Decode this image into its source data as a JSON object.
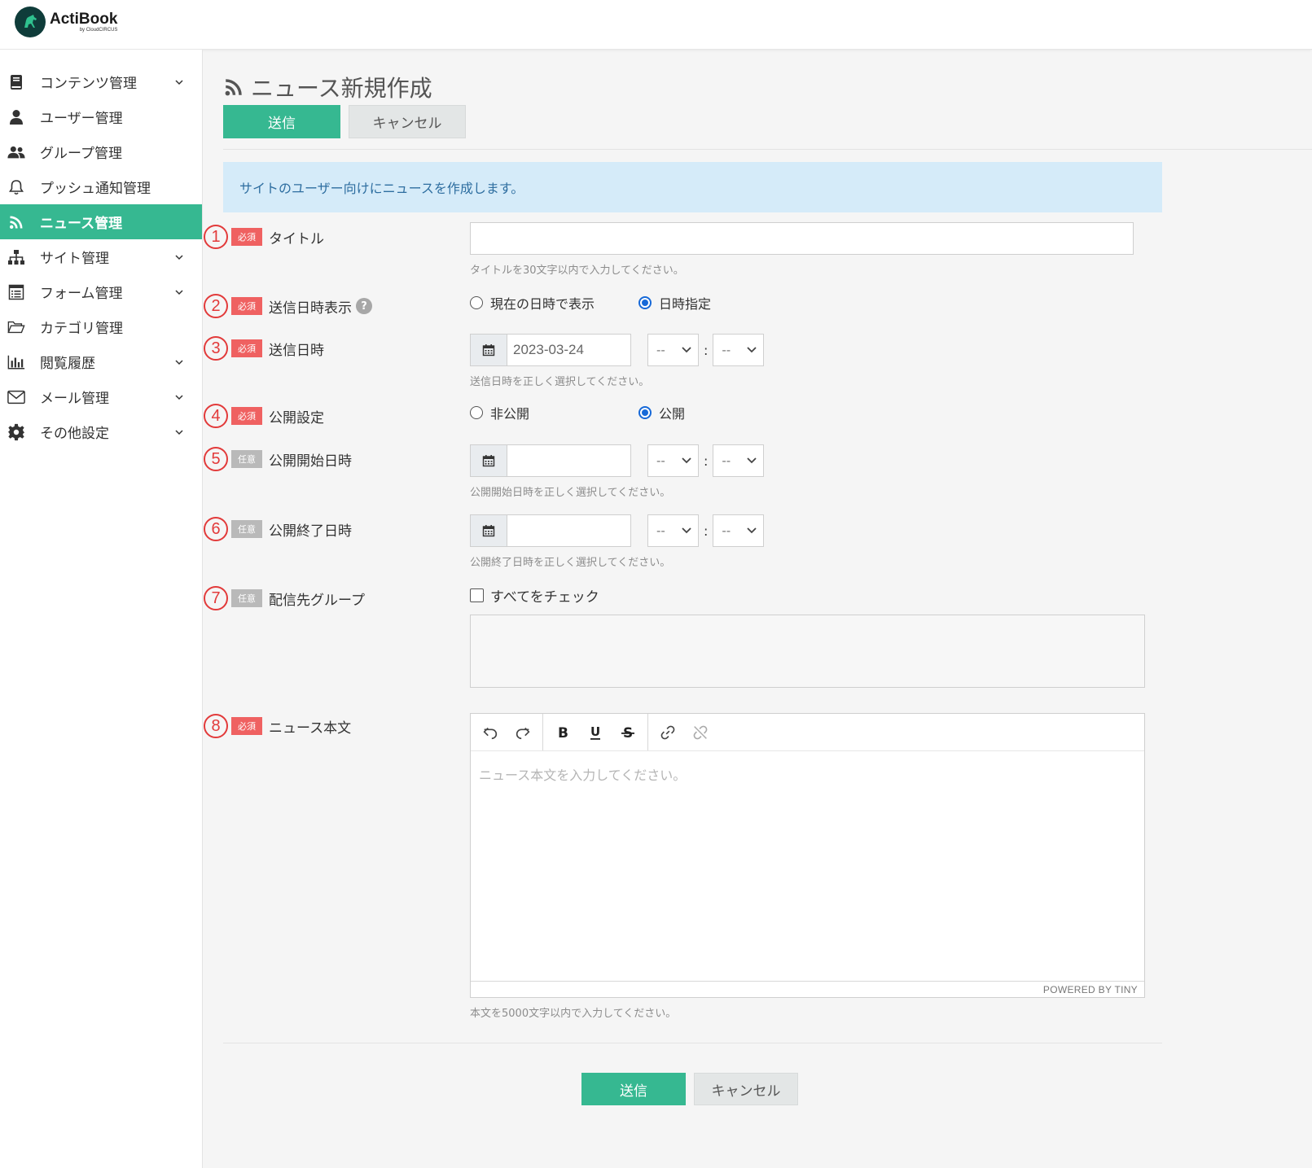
{
  "app": {
    "name": "ActiBook",
    "sub": "by CloudCIRCUS",
    "accent_color": "#36b891"
  },
  "sidebar": {
    "items": [
      {
        "label": "コンテンツ管理",
        "icon": "book-icon",
        "chevron": true,
        "active": false
      },
      {
        "label": "ユーザー管理",
        "icon": "user-icon",
        "chevron": false,
        "active": false
      },
      {
        "label": "グループ管理",
        "icon": "users-icon",
        "chevron": false,
        "active": false
      },
      {
        "label": "プッシュ通知管理",
        "icon": "bell-icon",
        "chevron": false,
        "active": false
      },
      {
        "label": "ニュース管理",
        "icon": "rss-icon",
        "chevron": false,
        "active": true
      },
      {
        "label": "サイト管理",
        "icon": "sitemap-icon",
        "chevron": true,
        "active": false
      },
      {
        "label": "フォーム管理",
        "icon": "form-icon",
        "chevron": true,
        "active": false
      },
      {
        "label": "カテゴリ管理",
        "icon": "folder-icon",
        "chevron": false,
        "active": false
      },
      {
        "label": "閲覧履歴",
        "icon": "bar-chart-icon",
        "chevron": true,
        "active": false
      },
      {
        "label": "メール管理",
        "icon": "envelope-icon",
        "chevron": true,
        "active": false
      },
      {
        "label": "その他設定",
        "icon": "gear-icon",
        "chevron": true,
        "active": false
      }
    ]
  },
  "page": {
    "title": "ニュース新規作成",
    "submit_label": "送信",
    "cancel_label": "キャンセル",
    "info_text": "サイトのユーザー向けにニュースを作成します。"
  },
  "badges": {
    "required": "必須",
    "optional": "任意"
  },
  "form": {
    "title": {
      "num": "1",
      "label": "タイトル",
      "value": "",
      "hint": "タイトルを30文字以内で入力してください。"
    },
    "display_mode": {
      "num": "2",
      "label": "送信日時表示",
      "help": "?",
      "options": [
        "現在の日時で表示",
        "日時指定"
      ],
      "selected": "日時指定"
    },
    "send_datetime": {
      "num": "3",
      "label": "送信日時",
      "date": "2023-03-24",
      "hour": "--",
      "minute": "--",
      "hint": "送信日時を正しく選択してください。"
    },
    "visibility": {
      "num": "4",
      "label": "公開設定",
      "options": [
        "非公開",
        "公開"
      ],
      "selected": "公開"
    },
    "publish_start": {
      "num": "5",
      "label": "公開開始日時",
      "date": "",
      "hour": "--",
      "minute": "--",
      "hint": "公開開始日時を正しく選択してください。"
    },
    "publish_end": {
      "num": "6",
      "label": "公開終了日時",
      "date": "",
      "hour": "--",
      "minute": "--",
      "hint": "公開終了日時を正しく選択してください。"
    },
    "groups": {
      "num": "7",
      "label": "配信先グループ",
      "check_all": "すべてをチェック",
      "checked": false
    },
    "body": {
      "num": "8",
      "label": "ニュース本文",
      "placeholder": "ニュース本文を入力してください。",
      "powered_by": "POWERED BY TINY",
      "hint": "本文を5000文字以内で入力してください。"
    }
  }
}
